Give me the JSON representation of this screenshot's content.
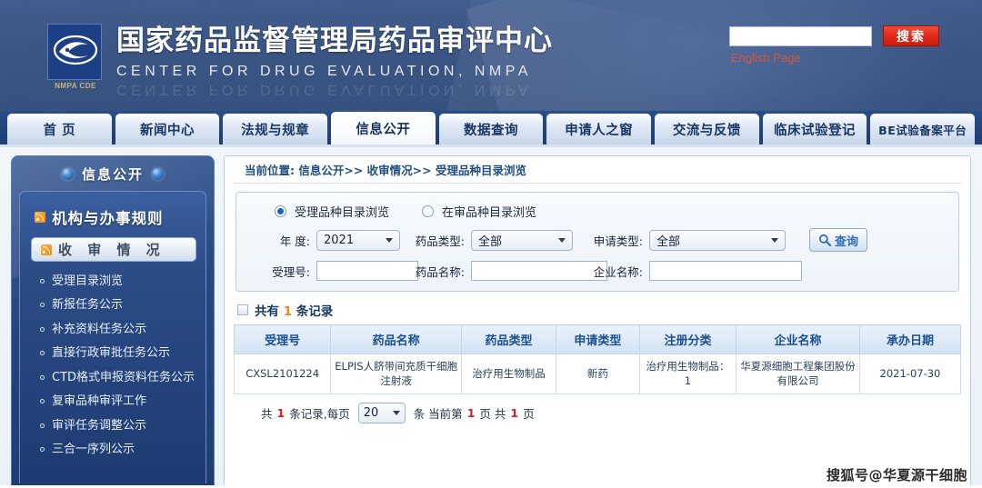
{
  "header": {
    "logo_label": "NMPA CDE",
    "title_cn": "国家药品监督管理局药品审评中心",
    "title_en": "CENTER FOR DRUG EVALUATION, NMPA",
    "search_value": "",
    "search_placeholder": "",
    "search_button": "搜索",
    "english_link": "English Page"
  },
  "nav": {
    "items": [
      {
        "label": "首 页"
      },
      {
        "label": "新闻中心"
      },
      {
        "label": "法规与规章"
      },
      {
        "label": "信息公开"
      },
      {
        "label": "数据查询"
      },
      {
        "label": "申请人之窗"
      },
      {
        "label": "交流与反馈"
      },
      {
        "label": "临床试验登记"
      },
      {
        "label": "BE试验备案平台"
      }
    ],
    "active_index": 3
  },
  "sidebar": {
    "header": "信息公开",
    "section_title": "机构与办事规则",
    "current": "收 审 情 况",
    "items": [
      {
        "label": "受理目录浏览"
      },
      {
        "label": "新报任务公示"
      },
      {
        "label": "补充资料任务公示"
      },
      {
        "label": "直接行政审批任务公示"
      },
      {
        "label": "CTD格式申报资料任务公示"
      },
      {
        "label": "复审品种审评工作"
      },
      {
        "label": "审评任务调整公示"
      },
      {
        "label": "三合一序列公示"
      }
    ]
  },
  "main": {
    "breadcrumb": "当前位置: 信息公开>> 收审情况>> 受理品种目录浏览",
    "radios": [
      {
        "label": "受理品种目录浏览",
        "checked": true
      },
      {
        "label": "在审品种目录浏览",
        "checked": false
      }
    ],
    "form": {
      "year_label": "年 度:",
      "year_value": "2021",
      "drug_type_label": "药品类型:",
      "drug_type_value": "全部",
      "apply_type_label": "申请类型:",
      "apply_type_value": "全部",
      "accept_no_label": "受理号:",
      "accept_no_value": "",
      "drug_name_label": "药品名称:",
      "drug_name_value": "",
      "company_label": "企业名称:",
      "company_value": "",
      "query_button": "查询"
    },
    "count": {
      "prefix": "共有",
      "number": "1",
      "suffix": "条记录"
    },
    "table": {
      "columns": [
        "受理号",
        "药品名称",
        "药品类型",
        "申请类型",
        "注册分类",
        "企业名称",
        "承办日期"
      ],
      "rows": [
        {
          "accept_no": "CXSL2101224",
          "drug_name": "ELPIS人脐带间充质干细胞注射液",
          "drug_type": "治疗用生物制品",
          "apply_type": "新药",
          "reg_class": "治疗用生物制品：1",
          "company": "华夏源细胞工程集团股份有限公司",
          "date": "2021-07-30"
        }
      ]
    },
    "pager": {
      "t1": "共",
      "total_records": "1",
      "t2": "条记录,每页",
      "page_size": "20",
      "t3": "条 当前第",
      "current_page": "1",
      "t4": "页 共",
      "total_pages": "1",
      "t5": "页"
    }
  },
  "watermark": "搜狐号@华夏源干细胞"
}
